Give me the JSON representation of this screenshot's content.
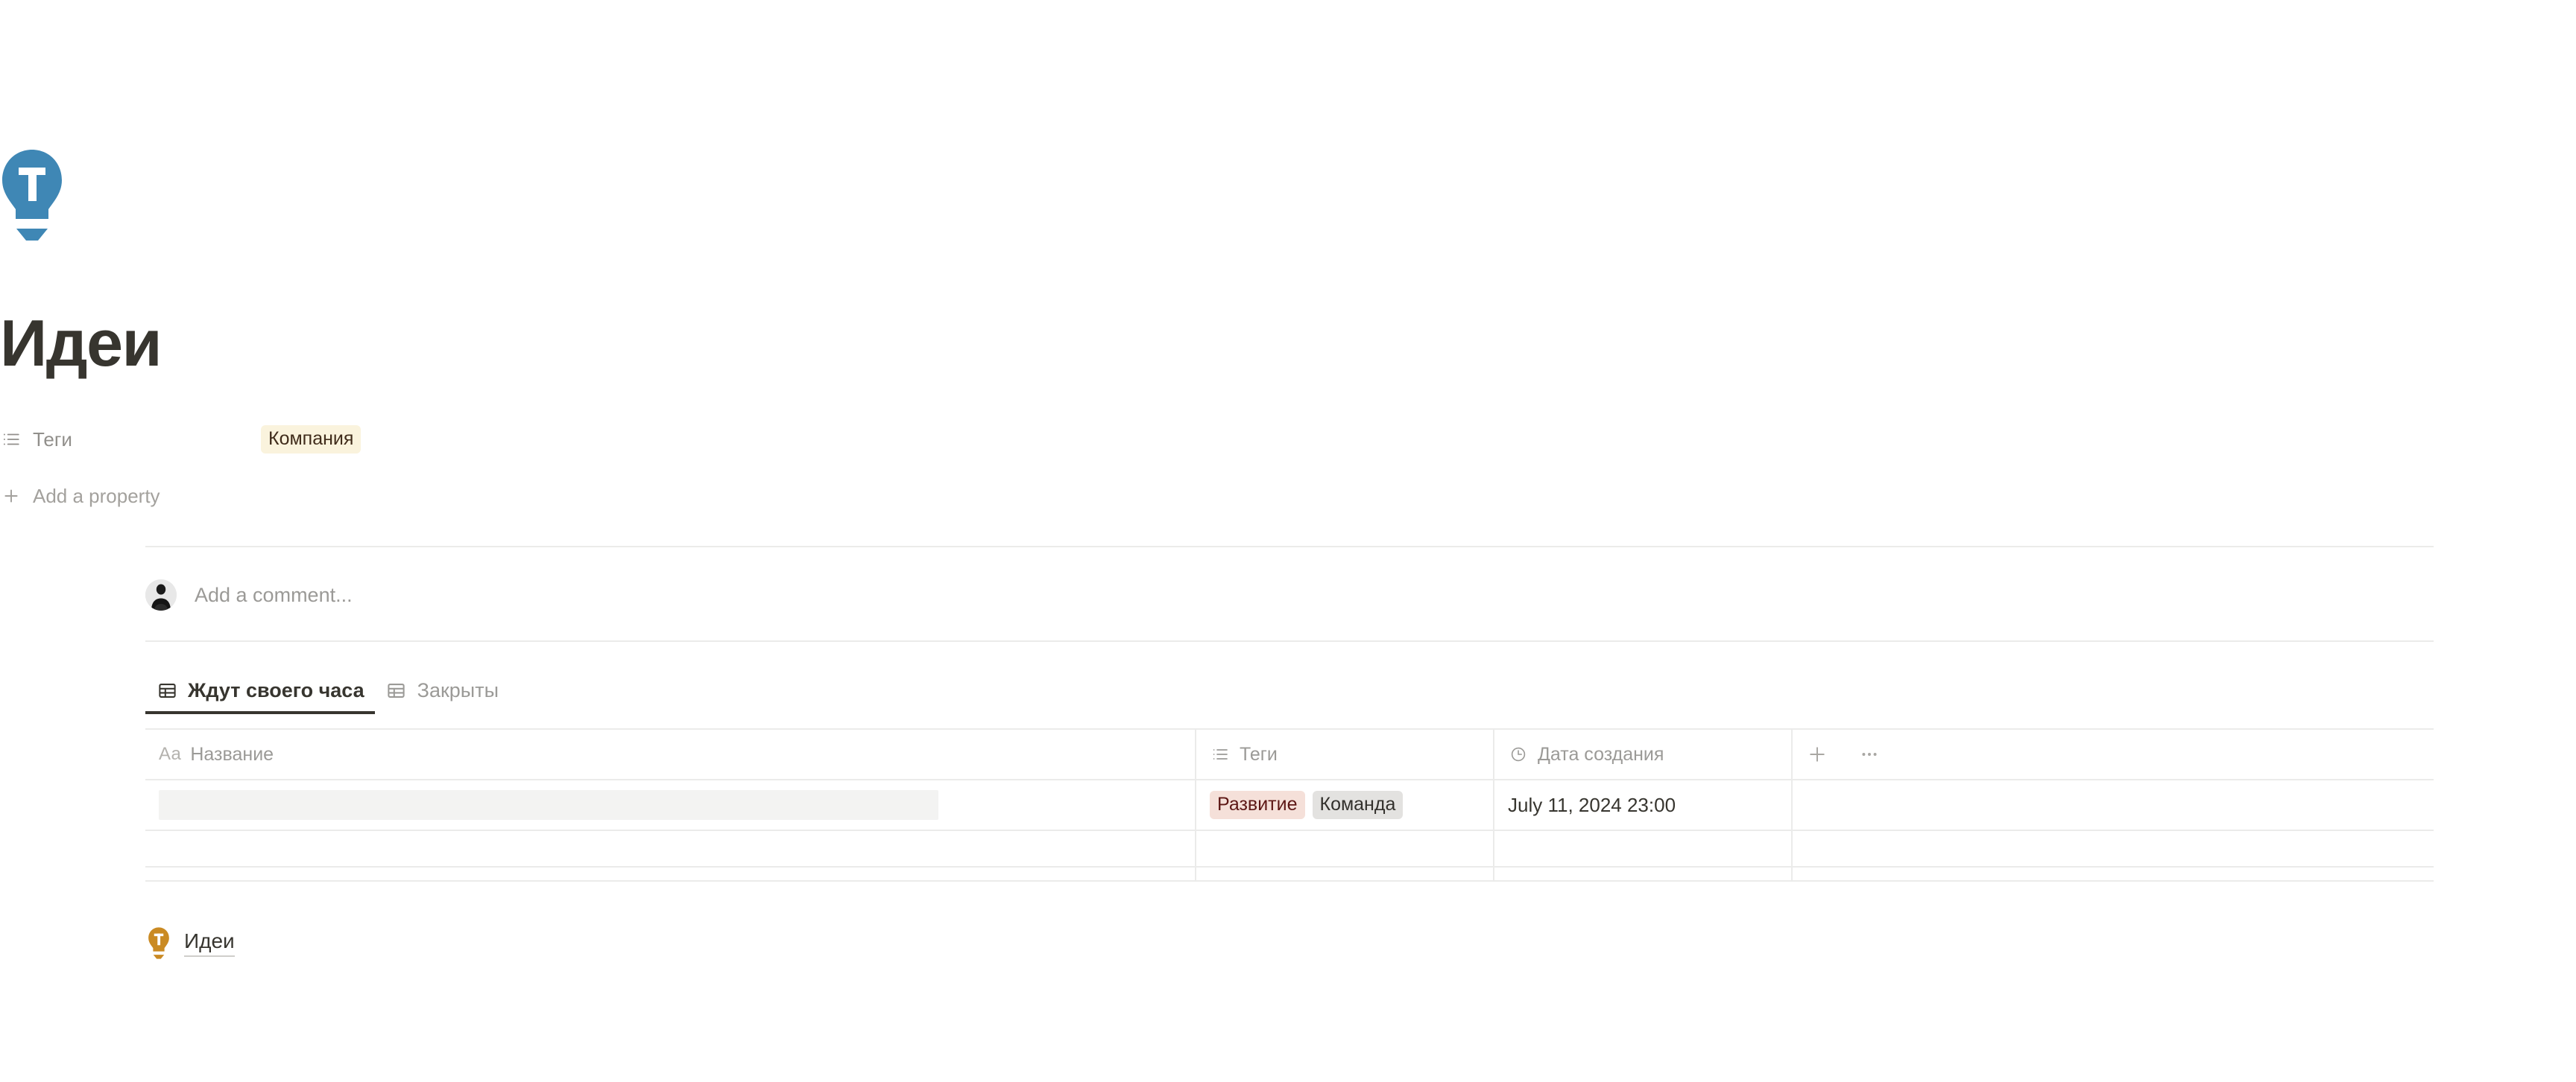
{
  "page": {
    "icon": "lightbulb-icon-blue",
    "icon_color": "#3f87b5",
    "title": "Идеи"
  },
  "properties": {
    "rows": [
      {
        "icon": "multi-select-icon",
        "label": "Теги",
        "tags": [
          {
            "text": "Компания",
            "style": "yellow",
            "bg": "#faf3dd",
            "fg": "#402c1b"
          }
        ]
      }
    ],
    "add_property_label": "Add a property",
    "add_property_icon": "plus-icon"
  },
  "comment": {
    "avatar": "user-avatar-photo",
    "placeholder": "Add a comment..."
  },
  "tabs": [
    {
      "label": "Ждут своего часа",
      "icon": "table-view-icon",
      "active": true
    },
    {
      "label": "Закрыты",
      "icon": "table-view-icon",
      "active": false
    }
  ],
  "table": {
    "columns": [
      {
        "label": "Название",
        "icon": "title-aa-icon",
        "type": "title"
      },
      {
        "label": "Теги",
        "icon": "multi-select-icon",
        "type": "multi_select"
      },
      {
        "label": "Дата создания",
        "icon": "clock-icon",
        "type": "created_time"
      }
    ],
    "add_column_icon": "plus-icon",
    "more_options_icon": "ellipsis-icon",
    "rows": [
      {
        "name": "",
        "name_redacted": true,
        "tags": [
          {
            "text": "Развитие",
            "style": "pink",
            "bg": "#f5e0d9",
            "fg": "#5d1715"
          },
          {
            "text": "Команда",
            "style": "gray",
            "bg": "#e3e2e0",
            "fg": "#32302c"
          }
        ],
        "created": "July 11, 2024 23:00"
      }
    ]
  },
  "bottom_link": {
    "icon": "lightbulb-icon-orange",
    "icon_color": "#ca8a23",
    "label": "Идеи"
  }
}
